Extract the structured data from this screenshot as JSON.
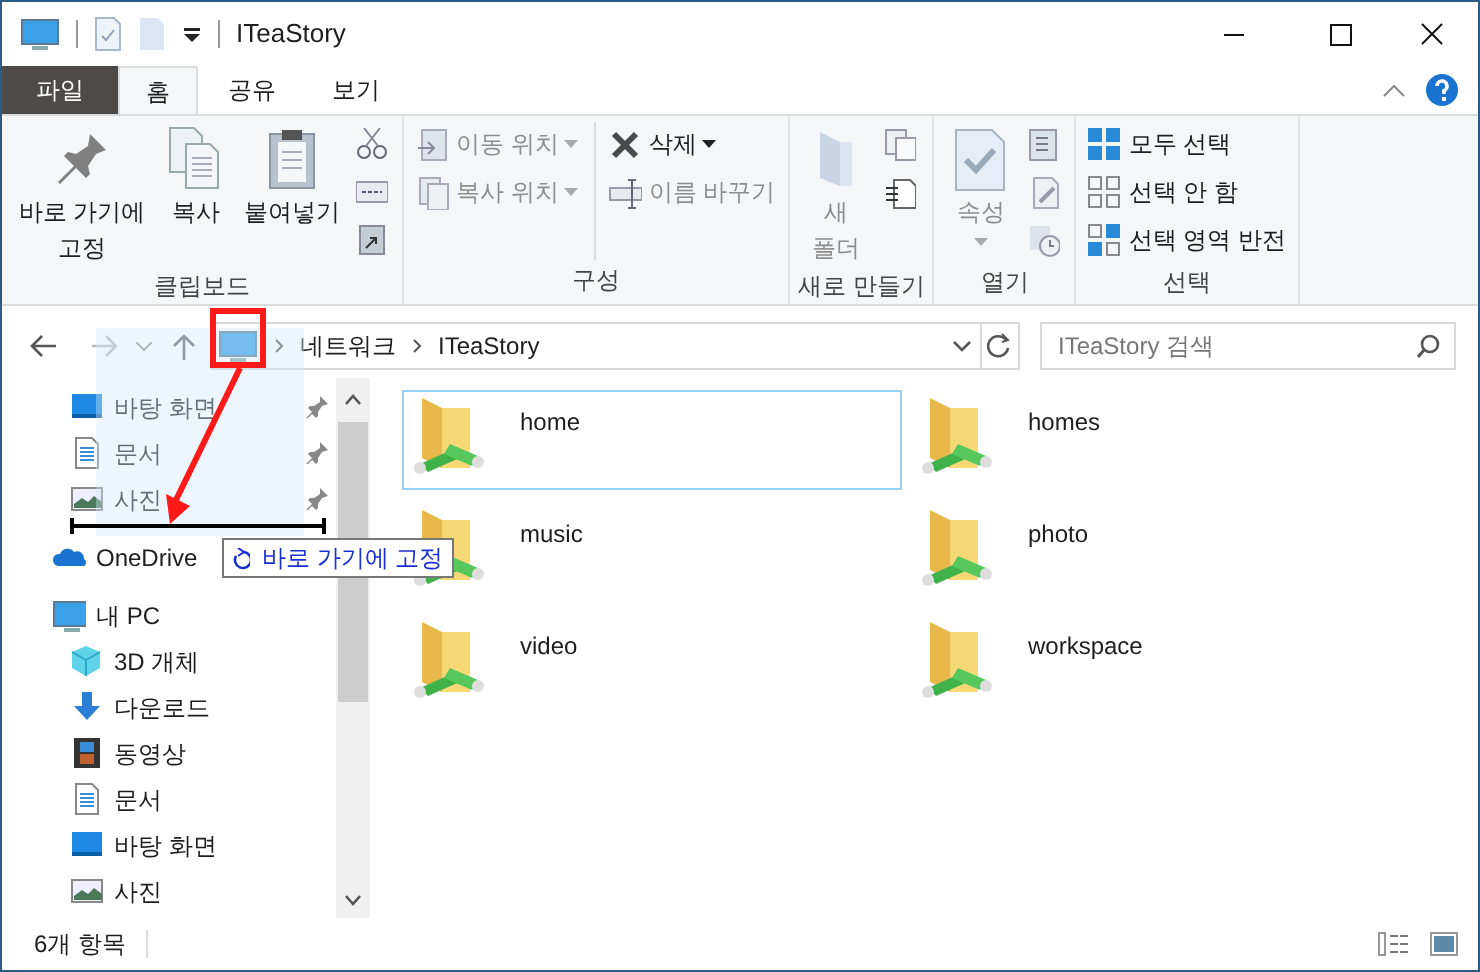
{
  "window": {
    "title": "ITeaStory"
  },
  "ribbon_tabs": [
    {
      "label": "파일",
      "kind": "file",
      "selected": false
    },
    {
      "label": "홈",
      "kind": "tab",
      "selected": true
    },
    {
      "label": "공유",
      "kind": "tab",
      "selected": false
    },
    {
      "label": "보기",
      "kind": "tab",
      "selected": false
    }
  ],
  "ribbon_groups": [
    {
      "label": "클립보드",
      "columns": [
        [
          {
            "kind": "pin",
            "label": "바로 가기에 고정",
            "disabled": false
          }
        ],
        [
          {
            "kind": "copy",
            "label": "복사",
            "disabled": false
          }
        ],
        [
          {
            "kind": "paste",
            "label": "붙여넣기",
            "disabled": false
          }
        ],
        [
          {
            "kind": "cut"
          },
          {
            "kind": "copypath"
          },
          {
            "kind": "pasteshortcut"
          }
        ]
      ]
    },
    {
      "label": "구성",
      "columns": [
        [
          {
            "kind": "move",
            "label": "이동 위치",
            "disabled": true,
            "dropdown": true
          },
          {
            "kind": "copyto",
            "label": "복사 위치",
            "disabled": true,
            "dropdown": true
          }
        ],
        [
          {
            "kind": "delete",
            "label": "삭제",
            "disabled": false,
            "dropdown": true
          },
          {
            "kind": "rename",
            "label": "이름 바꾸기",
            "disabled": true
          }
        ]
      ]
    },
    {
      "label": "새로 만들기",
      "columns": [
        [
          {
            "kind": "newfolder",
            "label": "새 폴더",
            "disabled": true
          }
        ],
        [
          {
            "kind": "newitem"
          },
          {
            "kind": "easyaccess"
          }
        ]
      ]
    },
    {
      "label": "열기",
      "columns": [
        [
          {
            "kind": "properties",
            "label": "속성",
            "disabled": true,
            "dropdown": true
          }
        ],
        [
          {
            "kind": "open"
          },
          {
            "kind": "edit"
          },
          {
            "kind": "history"
          }
        ]
      ]
    },
    {
      "label": "선택",
      "columns": [
        [
          {
            "kind": "selectall",
            "label": "모두 선택",
            "disabled": false
          },
          {
            "kind": "selectnone",
            "label": "선택 안 함",
            "disabled": false
          },
          {
            "kind": "invert",
            "label": "선택 영역 반전",
            "disabled": false
          }
        ]
      ]
    }
  ],
  "address_bar": {
    "path": [
      "네트워크",
      "ITeaStory"
    ]
  },
  "search": {
    "placeholder": "ITeaStory 검색"
  },
  "nav_pane": {
    "quick_access": [
      {
        "label": "바탕 화면",
        "kind": "desktop",
        "pinned": true
      },
      {
        "label": "문서",
        "kind": "documents",
        "pinned": true
      },
      {
        "label": "사진",
        "kind": "pictures",
        "pinned": true
      }
    ],
    "items": [
      {
        "label": "OneDrive",
        "kind": "onedrive"
      },
      {
        "label": "내 PC",
        "kind": "pc",
        "children": [
          {
            "label": "3D 개체",
            "kind": "objects3d"
          },
          {
            "label": "다운로드",
            "kind": "downloads"
          },
          {
            "label": "동영상",
            "kind": "videos"
          },
          {
            "label": "문서",
            "kind": "documents"
          },
          {
            "label": "바탕 화면",
            "kind": "desktop"
          },
          {
            "label": "사진",
            "kind": "pictures"
          }
        ]
      }
    ]
  },
  "files": [
    {
      "name": "home",
      "selected": true
    },
    {
      "name": "homes",
      "selected": false
    },
    {
      "name": "music",
      "selected": false
    },
    {
      "name": "photo",
      "selected": false
    },
    {
      "name": "video",
      "selected": false
    },
    {
      "name": "workspace",
      "selected": false
    }
  ],
  "drag_tooltip": {
    "label": "바로 가기에 고정"
  },
  "status_bar": {
    "item_count": "6개 항목"
  }
}
